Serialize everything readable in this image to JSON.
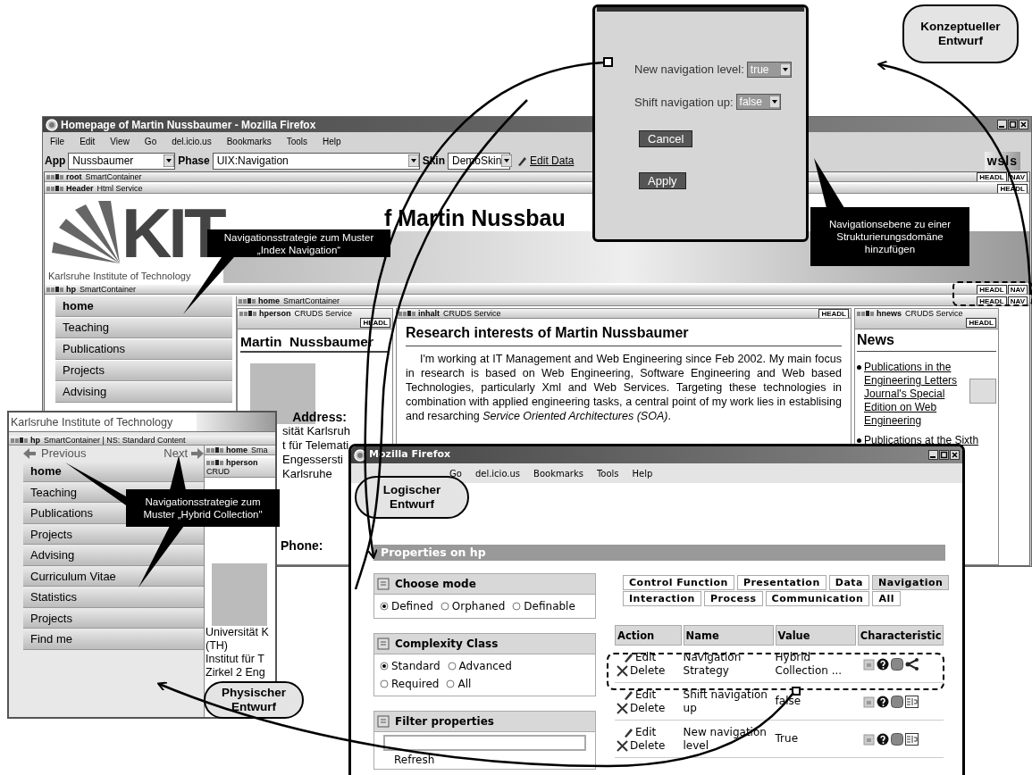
{
  "main_window": {
    "title": "Homepage of Martin Nussbaumer - Mozilla Firefox",
    "menu": [
      "File",
      "Edit",
      "View",
      "Go",
      "del.icio.us",
      "Bookmarks",
      "Tools",
      "Help"
    ],
    "toolbar": [
      {
        "label": "App",
        "value": "Nussbaumer"
      },
      {
        "label": "Phase",
        "value": "UIX:Navigation"
      },
      {
        "label": "Skin",
        "value": "DemoSkin"
      }
    ],
    "edit_data": "Edit Data",
    "brand": "wsls",
    "root_bar": {
      "name": "root",
      "type": "SmartContainer",
      "badges": [
        "HEADL",
        "NAV"
      ]
    },
    "header_bar": {
      "name": "Header",
      "type": "Html Service",
      "badges": [
        "HEADL"
      ]
    },
    "logo_text": "KIT",
    "logo_caption": "Karlsruhe Institute of Technology",
    "heading": "f Martin Nussbau",
    "hp_bar": {
      "name": "hp",
      "type": "SmartContainer",
      "badges": [
        "HEADL",
        "NAV"
      ]
    },
    "nav_items": [
      {
        "label": "home",
        "selected": true
      },
      {
        "label": "Teaching",
        "selected": false
      },
      {
        "label": "Publications",
        "selected": false
      },
      {
        "label": "Projects",
        "selected": false
      },
      {
        "label": "Advising",
        "selected": false
      }
    ],
    "home_bar": {
      "name": "home",
      "type": "SmartContainer",
      "badges": [
        "HEADL",
        "NAV"
      ]
    },
    "person": {
      "bar": {
        "name": "hperson",
        "type": "CRUDS Service",
        "badges": [
          "HEADL"
        ]
      },
      "name": "Martin  Nussbaumer",
      "address_label": "Address:",
      "address_lines": [
        "sität Karlsruh",
        "t für Telemati",
        "Engessersti",
        "Karlsruhe"
      ],
      "phone_label": "Phone:"
    },
    "content": {
      "bar": {
        "name": "inhalt",
        "type": "CRUDS Service",
        "badges": [
          "HEADL"
        ]
      },
      "heading": "Research interests of Martin Nussbaumer",
      "paragraph": "I'm working at IT Management and Web Engineering since Feb 2002. My main focus in research is based on Web Engineering, Software Engineering and Web based Technologies, particularly Xml and Web Services. Targeting these technologies in combination with applied engineering tasks, a central point of my work lies in establising and resarching *Service Oriented Architectures (SOA)*."
    },
    "news": {
      "bar": {
        "name": "hnews",
        "type": "CRUDS Service",
        "badges": [
          "HEADL"
        ]
      },
      "heading": "News",
      "items": [
        "Publications in the Engineering Letters Journal's Special Edition on Web Engineering",
        "Publications at the Sixth"
      ]
    }
  },
  "dialog": {
    "fields": [
      {
        "label": "New navigation level:",
        "value": "true"
      },
      {
        "label": "Shift navigation up:",
        "value": "false"
      }
    ],
    "buttons": [
      "Cancel",
      "Apply"
    ]
  },
  "mobile_window": {
    "header_text": "Karlsruhe Institute of Technology",
    "bar": {
      "name": "hp",
      "type": "SmartContainer | NS: Standard Content"
    },
    "previous": "Previous",
    "next": "Next",
    "nav_items": [
      {
        "label": "home",
        "selected": true
      },
      {
        "label": "Teaching",
        "selected": false
      },
      {
        "label": "Publications",
        "selected": false
      },
      {
        "label": "Projects",
        "selected": false
      },
      {
        "label": "Advising",
        "selected": false
      },
      {
        "label": "Curriculum Vitae",
        "selected": false
      },
      {
        "label": "Statistics",
        "selected": false
      },
      {
        "label": "Projects",
        "selected": false
      },
      {
        "label": "Find me",
        "selected": false
      }
    ],
    "home_bar": {
      "name": "home",
      "type": "Sma"
    },
    "person_bar": {
      "name": "hperson",
      "type": "CRUD"
    },
    "address_lines": [
      "Universität K",
      "(TH)",
      "Institut für T",
      "Zirkel 2 Eng"
    ]
  },
  "properties_window": {
    "title": "Mozilla Firefox",
    "menu": [
      "Go",
      "del.icio.us",
      "Bookmarks",
      "Tools",
      "Help"
    ],
    "heading": "Properties on hp",
    "panels": [
      {
        "kind": "radio",
        "title": "Choose mode",
        "options": [
          {
            "label": "Defined",
            "selected": true
          },
          {
            "label": "Orphaned",
            "selected": false
          },
          {
            "label": "Definable",
            "selected": false
          }
        ]
      },
      {
        "kind": "radio",
        "title": "Complexity Class",
        "options": [
          {
            "label": "Standard",
            "selected": true
          },
          {
            "label": "Advanced",
            "selected": false
          },
          {
            "label": "Required",
            "selected": false
          },
          {
            "label": "All",
            "selected": false
          }
        ]
      },
      {
        "kind": "filter",
        "title": "Filter properties",
        "button": "Refresh"
      }
    ],
    "tab_rows": [
      [
        {
          "label": "Control Function",
          "selected": false
        },
        {
          "label": "Presentation",
          "selected": false
        },
        {
          "label": "Data",
          "selected": false
        },
        {
          "label": "Navigation",
          "selected": true
        }
      ],
      [
        {
          "label": "Interaction",
          "selected": false
        },
        {
          "label": "Process",
          "selected": false
        },
        {
          "label": "Communication",
          "selected": false
        },
        {
          "label": "All",
          "selected": false
        }
      ]
    ],
    "table": {
      "columns": [
        "Action",
        "Name",
        "Value",
        "Characteristic"
      ],
      "rows": [
        {
          "edit": "Edit",
          "delete": "Delete",
          "name": "Navigation Strategy",
          "value": "Hybrid Collection ...",
          "kind": "graph"
        },
        {
          "edit": "Edit",
          "delete": "Delete",
          "name": "Shift navigation up",
          "value": "false",
          "kind": "boolean"
        },
        {
          "edit": "Edit",
          "delete": "Delete",
          "name": "New navigation level",
          "value": "True",
          "kind": "boolean"
        }
      ]
    }
  },
  "callouts": [
    "Navigationsstrategie zum Muster „Index Navigation“",
    "Navigationsebene zu einer Strukturierungsdomäne hinzufügen",
    "Navigationsstrategie zum Muster „Hybrid Collection\""
  ],
  "bubbles": [
    "Konzeptueller Entwurf",
    "Logischer Entwurf",
    "Physischer Entwurf"
  ]
}
